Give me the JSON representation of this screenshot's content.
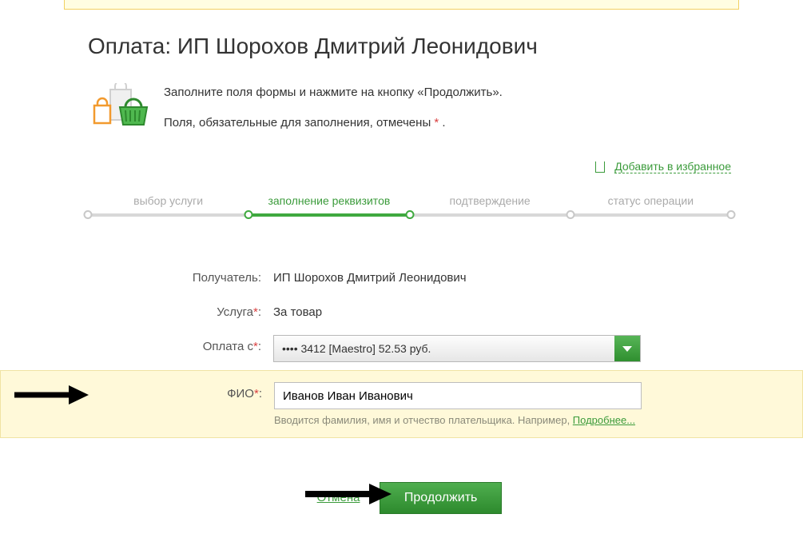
{
  "page_title": "Оплата: ИП Шорохов Дмитрий Леонидович",
  "intro": {
    "line1": "Заполните поля формы и нажмите на кнопку «Продолжить».",
    "line2_prefix": "Поля, обязательные для заполнения, отмечены ",
    "line2_suffix": " ."
  },
  "favorite_link": "Добавить в избранное",
  "steps": [
    {
      "label": "выбор услуги",
      "active": false
    },
    {
      "label": "заполнение реквизитов",
      "active": true
    },
    {
      "label": "подтверждение",
      "active": false
    },
    {
      "label": "статус операции",
      "active": false
    }
  ],
  "form": {
    "recipient": {
      "label": "Получатель:",
      "value": "ИП Шорохов Дмитрий Леонидович"
    },
    "service": {
      "label": "Услуга",
      "value": "За товар"
    },
    "pay_from": {
      "label": "Оплата с",
      "value": "•••• 3412 [Maestro] 52.53 руб."
    },
    "fio": {
      "label": "ФИО",
      "value": "Иванов Иван Иванович",
      "hint_prefix": "Вводится фамилия, имя и отчество плательщика. Например, ",
      "hint_link": "Подробнее..."
    }
  },
  "actions": {
    "cancel": "Отмена",
    "continue": "Продолжить"
  },
  "required_marker": "*"
}
